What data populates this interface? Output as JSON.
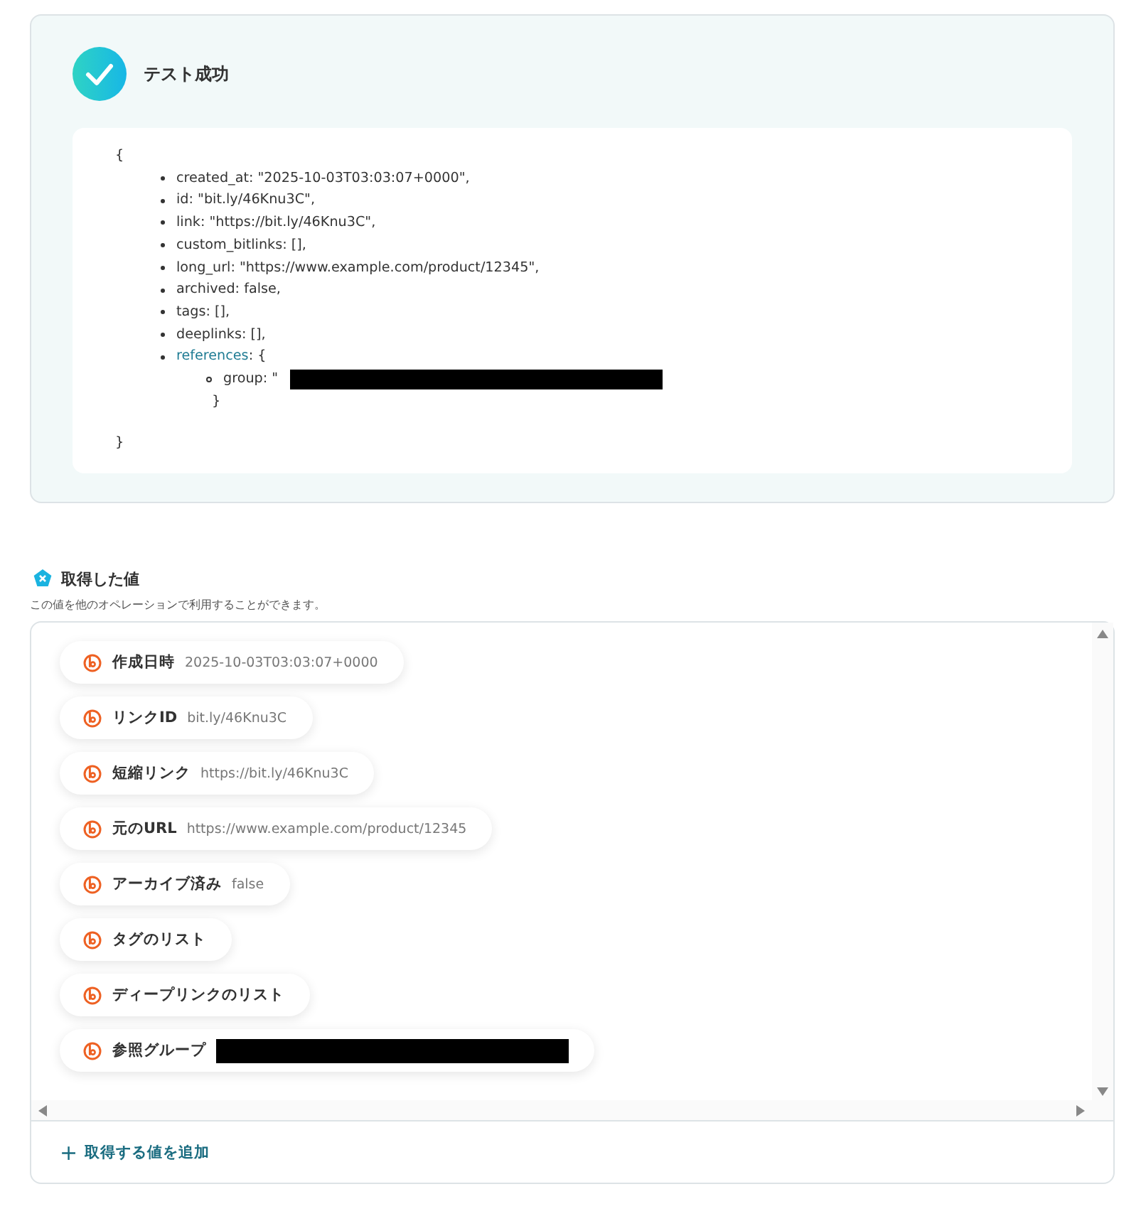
{
  "test_result": {
    "succeeded": true,
    "title": "テスト成功",
    "output": {
      "open": "{",
      "items": [
        {
          "text": "created_at: \"2025-10-03T03:03:07+0000\","
        },
        {
          "text": "id: \"bit.ly/46Knu3C\","
        },
        {
          "text": "link: \"https://bit.ly/46Knu3C\","
        },
        {
          "text": "custom_bitlinks: [],"
        },
        {
          "text": "long_url: \"https://www.example.com/product/12345\","
        },
        {
          "text": "archived: false,"
        },
        {
          "text": "tags: [],"
        },
        {
          "text": "deeplinks: [],"
        },
        {
          "key": "references",
          "text": ": {",
          "children": [
            {
              "text": "group: \"",
              "redacted": true
            }
          ],
          "close": "}"
        }
      ],
      "close": "}"
    }
  },
  "values": {
    "title": "取得した値",
    "description": "この値を他のオペレーションで利用することができます。",
    "items": [
      {
        "label": "作成日時",
        "value": "2025-10-03T03:03:07+0000"
      },
      {
        "label": "リンクID",
        "value": "bit.ly/46Knu3C"
      },
      {
        "label": "短縮リンク",
        "value": "https://bit.ly/46Knu3C"
      },
      {
        "label": "元のURL",
        "value": "https://www.example.com/product/12345"
      },
      {
        "label": "アーカイブ済み",
        "value": "false"
      },
      {
        "label": "タグのリスト"
      },
      {
        "label": "ディープリンクのリスト"
      },
      {
        "label": "参照グループ",
        "redacted": true
      }
    ],
    "add_button": {
      "icon": "+",
      "label": "取得する値を追加"
    }
  }
}
